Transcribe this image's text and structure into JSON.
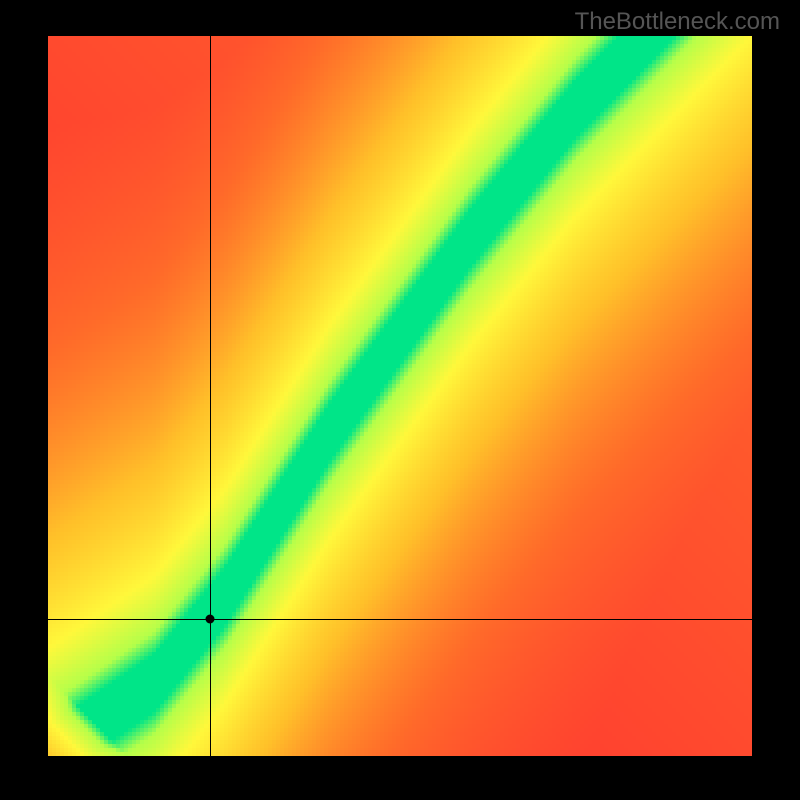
{
  "watermark": "TheBottleneck.com",
  "chart_data": {
    "type": "heatmap",
    "title": "",
    "xlabel": "",
    "ylabel": "",
    "xlim": [
      0,
      100
    ],
    "ylim": [
      0,
      100
    ],
    "crosshair": {
      "x": 23,
      "y": 19
    },
    "marker": {
      "x": 23,
      "y": 19
    },
    "ideal_curve_control_points": [
      {
        "x": 0,
        "y": 0
      },
      {
        "x": 15,
        "y": 10
      },
      {
        "x": 25,
        "y": 22
      },
      {
        "x": 40,
        "y": 45
      },
      {
        "x": 60,
        "y": 72
      },
      {
        "x": 75,
        "y": 90
      },
      {
        "x": 85,
        "y": 100
      }
    ],
    "color_stops": [
      {
        "t": 0.0,
        "color": "#ff2a33"
      },
      {
        "t": 0.25,
        "color": "#ff6a2a"
      },
      {
        "t": 0.5,
        "color": "#ffc029"
      },
      {
        "t": 0.75,
        "color": "#fff83b"
      },
      {
        "t": 0.92,
        "color": "#b5ff4a"
      },
      {
        "t": 1.0,
        "color": "#00e588"
      }
    ],
    "secondary_ridge": {
      "offset_below": 12,
      "strength": 0.65
    },
    "green_band_halfwidth": 4.0,
    "falloff_scale": 38.0
  },
  "canvas": {
    "w": 176,
    "h": 180
  }
}
